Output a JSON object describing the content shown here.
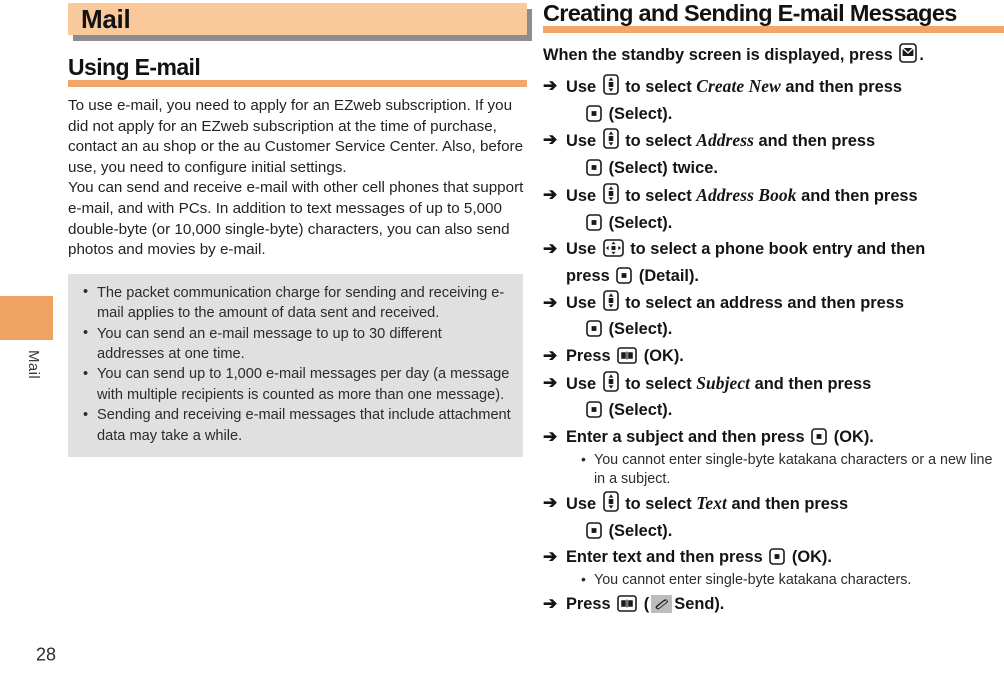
{
  "page": {
    "number": "28",
    "chapter_tab_label": "Mail",
    "tab_color": "#f0a262",
    "accent_color": "#f3a669",
    "chapter_bar_color": "#fac99b",
    "note_box_color": "#e0e0e0"
  },
  "left_column": {
    "chapter_title": "Mail",
    "section_heading": "Using E-mail",
    "paragraphs": [
      "To use e-mail, you need to apply for an EZweb subscription. If you did not apply for an EZweb subscription at the time of purchase, contact an au shop or the au Customer Service Center. Also, before use, you need to configure initial settings.",
      "You can send and receive e-mail with other cell phones that support e-mail, and with PCs. In addition to text messages of up to 5,000 double-byte (or 10,000 single-byte) characters, you can also send photos and movies by e-mail."
    ],
    "notes": [
      "The packet communication charge for sending and receiving e-mail applies to the amount of data sent and received.",
      "You can send an e-mail message to up to 30 different addresses at one time.",
      "You can send up to 1,000 e-mail messages per day (a message with multiple recipients is counted as more than one message).",
      "Sending and receiving e-mail messages that include attachment data may take a while."
    ]
  },
  "right_column": {
    "section_heading": "Creating and Sending E-mail Messages",
    "lead_prefix": "When the standby screen is displayed, press",
    "lead_suffix": ".",
    "lead_icon": "mail-envelope-key-icon",
    "steps": [
      {
        "id": "step-create-new",
        "line1_pre": "Use",
        "line1_icon": "updown-navigation-key-icon",
        "line1_mid": "to select",
        "menu_name": "Create New",
        "line1_post": "and then press",
        "line2_icon": "center-select-key-icon",
        "line2_text": "(Select)."
      },
      {
        "id": "step-address",
        "line1_pre": "Use",
        "line1_icon": "updown-navigation-key-icon",
        "line1_mid": "to select",
        "menu_name": "Address",
        "line1_post": "and then press",
        "line2_icon": "center-select-key-icon",
        "line2_text": "(Select) twice."
      },
      {
        "id": "step-address-book",
        "line1_pre": "Use",
        "line1_icon": "updown-navigation-key-icon",
        "line1_mid": "to select",
        "menu_name": "Address Book",
        "line1_post": "and then press",
        "line2_icon": "center-select-key-icon",
        "line2_text": "(Select)."
      },
      {
        "id": "step-phone-book-entry",
        "line1_pre": "Use",
        "line1_icon": "fourway-navigation-key-icon",
        "line1_mid": "to select a phone book entry and then",
        "line2_pre": "press",
        "line2_icon": "center-select-key-icon",
        "line2_text": "(Detail)."
      },
      {
        "id": "step-select-address",
        "line1_pre": "Use",
        "line1_icon": "updown-navigation-key-icon",
        "line1_mid": "to select an address and then press",
        "line2_icon": "center-select-key-icon",
        "line2_text": "(Select)."
      },
      {
        "id": "step-press-ok",
        "line1_pre": "Press",
        "line1_icon": "book-softkey-icon",
        "line1_post": "(OK)."
      },
      {
        "id": "step-subject",
        "line1_pre": "Use",
        "line1_icon": "updown-navigation-key-icon",
        "line1_mid": "to select",
        "menu_name": "Subject",
        "line1_post": "and then press",
        "line2_icon": "center-select-key-icon",
        "line2_text": "(Select)."
      },
      {
        "id": "step-enter-subject",
        "line1_pre": "Enter a subject and then press",
        "line1_icon": "center-select-key-icon",
        "line1_post": "(OK).",
        "substeps": [
          "You cannot enter single-byte katakana characters or a new line in a subject."
        ]
      },
      {
        "id": "step-text",
        "line1_pre": "Use",
        "line1_icon": "updown-navigation-key-icon",
        "line1_mid": "to select",
        "menu_name": "Text",
        "line1_post": "and then press",
        "line2_icon": "center-select-key-icon",
        "line2_text": "(Select)."
      },
      {
        "id": "step-enter-text",
        "line1_pre": "Enter text and then press",
        "line1_icon": "center-select-key-icon",
        "line1_post": "(OK).",
        "substeps": [
          "You cannot enter single-byte katakana characters."
        ]
      },
      {
        "id": "step-send",
        "line1_pre": "Press",
        "line1_icon": "book-softkey-icon",
        "line1_paren_open": "(",
        "send_icon": "phone-handset-send-icon",
        "line1_post": "Send)."
      }
    ]
  }
}
